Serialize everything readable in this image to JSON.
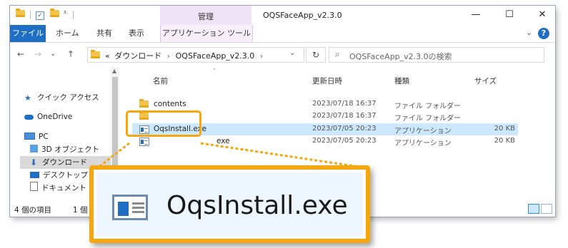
{
  "window": {
    "title": "OQSFaceApp_v2.3.0",
    "manage_label": "管理",
    "controls": {
      "minimize": "—",
      "maximize": "☐",
      "close": "✕"
    }
  },
  "ribbon": {
    "tabs": [
      "ファイル",
      "ホーム",
      "共有",
      "表示"
    ],
    "contextual_tab": "アプリケーション ツール",
    "collapse_glyph": "⌄",
    "help_glyph": "?"
  },
  "address": {
    "back": "←",
    "forward": "→",
    "recent": "⌄",
    "up": "↑",
    "overflow": "«",
    "crumbs": [
      "ダウンロード",
      "OQSFaceApp_v2.3.0"
    ],
    "crumb_sep": "›",
    "dropdown": "⌄",
    "refresh": "↻",
    "search_placeholder": "OQSFaceApp_v2.3.0の検索"
  },
  "navpane": {
    "items": [
      {
        "label": "クイック アクセス",
        "icon": "star-icon"
      },
      {
        "label": "OneDrive",
        "icon": "cloud-icon"
      },
      {
        "label": "PC",
        "icon": "pc-icon"
      },
      {
        "label": "3D オブジェクト",
        "icon": "cube-icon"
      },
      {
        "label": "ダウンロード",
        "icon": "download-arrow-icon",
        "selected": true
      },
      {
        "label": "デスクトップ",
        "icon": "desktop-icon"
      },
      {
        "label": "ドキュメント",
        "icon": "document-icon"
      }
    ]
  },
  "columns": [
    "名前",
    "更新日時",
    "種類",
    "サイズ"
  ],
  "files": [
    {
      "name": "contents",
      "modified": "2023/07/18 16:37",
      "type": "ファイル フォルダー",
      "size": "",
      "icon": "folder-icon"
    },
    {
      "name": "",
      "modified": "2023/07/18 16:37",
      "type": "ファイル フォルダー",
      "size": "",
      "icon": "folder-icon"
    },
    {
      "name": "OqsInstall.exe",
      "modified": "2023/07/05 20:23",
      "type": "アプリケーション",
      "size": "20 KB",
      "icon": "application-icon",
      "selected": true
    },
    {
      "name": "exe",
      "modified": "2023/07/05 20:23",
      "type": "アプリケーション",
      "size": "20 KB",
      "icon": "application-icon"
    }
  ],
  "status": {
    "count": "4 個の項目",
    "selected": "1 個"
  },
  "callout": {
    "zoom_label": "OqsInstall.exe",
    "accent": "#f4a70e"
  },
  "colors": {
    "file_tab": "#1e6fc4",
    "selection": "#cce8ff",
    "manage_tab": "#efe3f7"
  }
}
